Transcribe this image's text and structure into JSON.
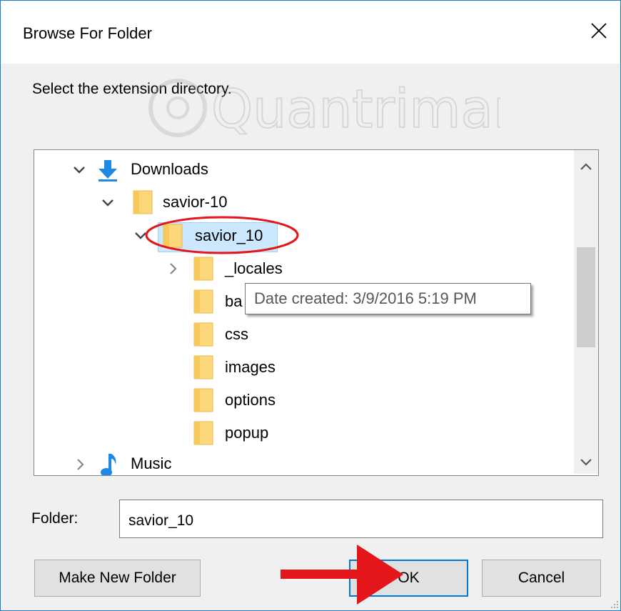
{
  "dialog": {
    "title": "Browse For Folder",
    "prompt": "Select the extension directory.",
    "watermark": "Quantrimang"
  },
  "tree": {
    "items": [
      {
        "label": "Downloads",
        "icon": "download-arrow-icon",
        "expanded": true
      },
      {
        "label": "savior-10",
        "icon": "folder-icon",
        "expanded": true
      },
      {
        "label": "savior_10",
        "icon": "folder-icon",
        "expanded": true,
        "selected": true
      },
      {
        "label": "_locales",
        "icon": "folder-icon",
        "expanded": false
      },
      {
        "label": "ba",
        "icon": "folder-icon"
      },
      {
        "label": "css",
        "icon": "folder-icon"
      },
      {
        "label": "images",
        "icon": "folder-icon"
      },
      {
        "label": "options",
        "icon": "folder-icon"
      },
      {
        "label": "popup",
        "icon": "folder-icon"
      },
      {
        "label": "Music",
        "icon": "music-note-icon",
        "expanded": false
      }
    ]
  },
  "tooltip": {
    "text": "Date created: 3/9/2016 5:19 PM"
  },
  "folder_field": {
    "label": "Folder:",
    "value": "savior_10"
  },
  "buttons": {
    "make_new_folder": "Make New Folder",
    "ok": "OK",
    "cancel": "Cancel"
  },
  "colors": {
    "accent": "#0078d7",
    "folder": "#fcd87a",
    "download_arrow": "#1e88e5",
    "annotation_red": "#e4161b",
    "selection": "#cce8ff"
  }
}
